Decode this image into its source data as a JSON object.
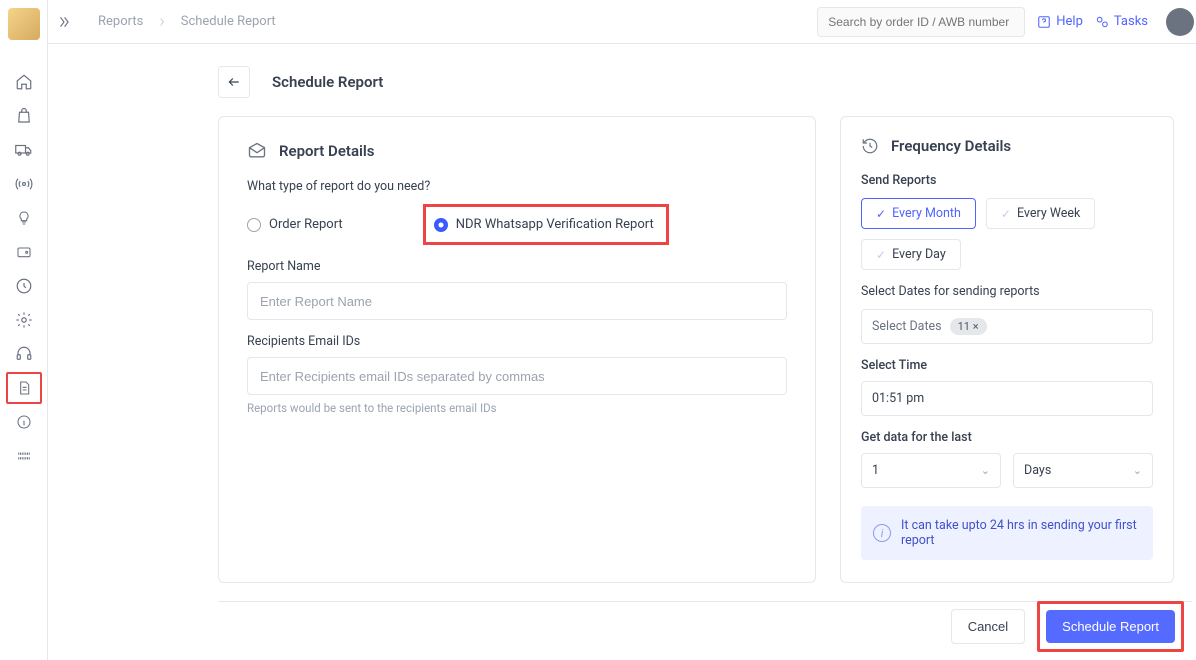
{
  "topbar": {
    "breadcrumb": [
      "Reports",
      "Schedule Report"
    ],
    "search_placeholder": "Search by order ID / AWB number",
    "help": "Help",
    "tasks": "Tasks"
  },
  "sidebar": {
    "icons": [
      "home",
      "bag",
      "truck",
      "broadcast",
      "bulb",
      "wallet",
      "refresh",
      "gear",
      "headset",
      "document",
      "info",
      "barcode"
    ],
    "active_index": 9
  },
  "page": {
    "title": "Schedule Report"
  },
  "report_details": {
    "section_title": "Report Details",
    "question": "What type of report do you need?",
    "options": [
      {
        "label": "Order Report",
        "selected": false
      },
      {
        "label": "NDR Whatsapp Verification Report",
        "selected": true
      }
    ],
    "name_label": "Report Name",
    "name_placeholder": "Enter Report Name",
    "recipients_label": "Recipients Email IDs",
    "recipients_placeholder": "Enter Recipients email IDs separated by commas",
    "recipients_hint": "Reports would be sent to the recipients email IDs"
  },
  "frequency": {
    "section_title": "Frequency Details",
    "send_label": "Send Reports",
    "freq_options": [
      {
        "label": "Every Month",
        "active": true
      },
      {
        "label": "Every Week",
        "active": false
      },
      {
        "label": "Every Day",
        "active": false
      }
    ],
    "dates_label": "Select Dates for sending reports",
    "dates_text": "Select Dates",
    "dates_chip": "11 ×",
    "time_label": "Select Time",
    "time_value": "01:51 pm",
    "range_label": "Get data for the last",
    "range_value": "1",
    "range_unit": "Days",
    "info": "It can take upto 24 hrs in sending your first report"
  },
  "footer": {
    "cancel": "Cancel",
    "submit": "Schedule Report"
  }
}
